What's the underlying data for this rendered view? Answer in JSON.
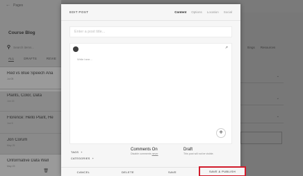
{
  "background": {
    "back_label": "Pages",
    "blog_title": "Course Blog",
    "search_placeholder": "Search items...",
    "filter_tabs": [
      "ALL",
      "DRAFTS",
      "REVIE"
    ],
    "posts": [
      {
        "title": "Red vs Blue Speech Ana",
        "date": "Jul 05"
      },
      {
        "title": "Plants, Color, Data",
        "date": "Jun 15"
      },
      {
        "title": "Florence: Hello Plant, He",
        "date": "Jun 5"
      },
      {
        "title": "Jon Corum",
        "date": "May 25"
      },
      {
        "title": "Onformative Data Wall",
        "date": "May 23"
      }
    ],
    "right_tabs": [
      "ttings",
      "Resources"
    ]
  },
  "modal": {
    "title": "EDIT POST",
    "tabs": [
      "Content",
      "Options",
      "Location",
      "Social"
    ],
    "active_tab": "Content",
    "title_placeholder": "Enter a post title...",
    "editor_placeholder": "Write here...",
    "tags_label": "TAGS",
    "categories_label": "CATEGORIES",
    "comments_heading": "Comments On",
    "comments_sub_prefix": "Disable comments",
    "comments_sub_link": "never",
    "status_heading": "Draft",
    "status_sub": "This post will not be visible.",
    "buttons": {
      "cancel": "CANCEL",
      "delete": "DELETE",
      "save": "SAVE",
      "publish": "SAVE & PUBLISH"
    }
  },
  "colors": {
    "highlight": "#d11a2a",
    "overlay": "#6f6f6f"
  }
}
